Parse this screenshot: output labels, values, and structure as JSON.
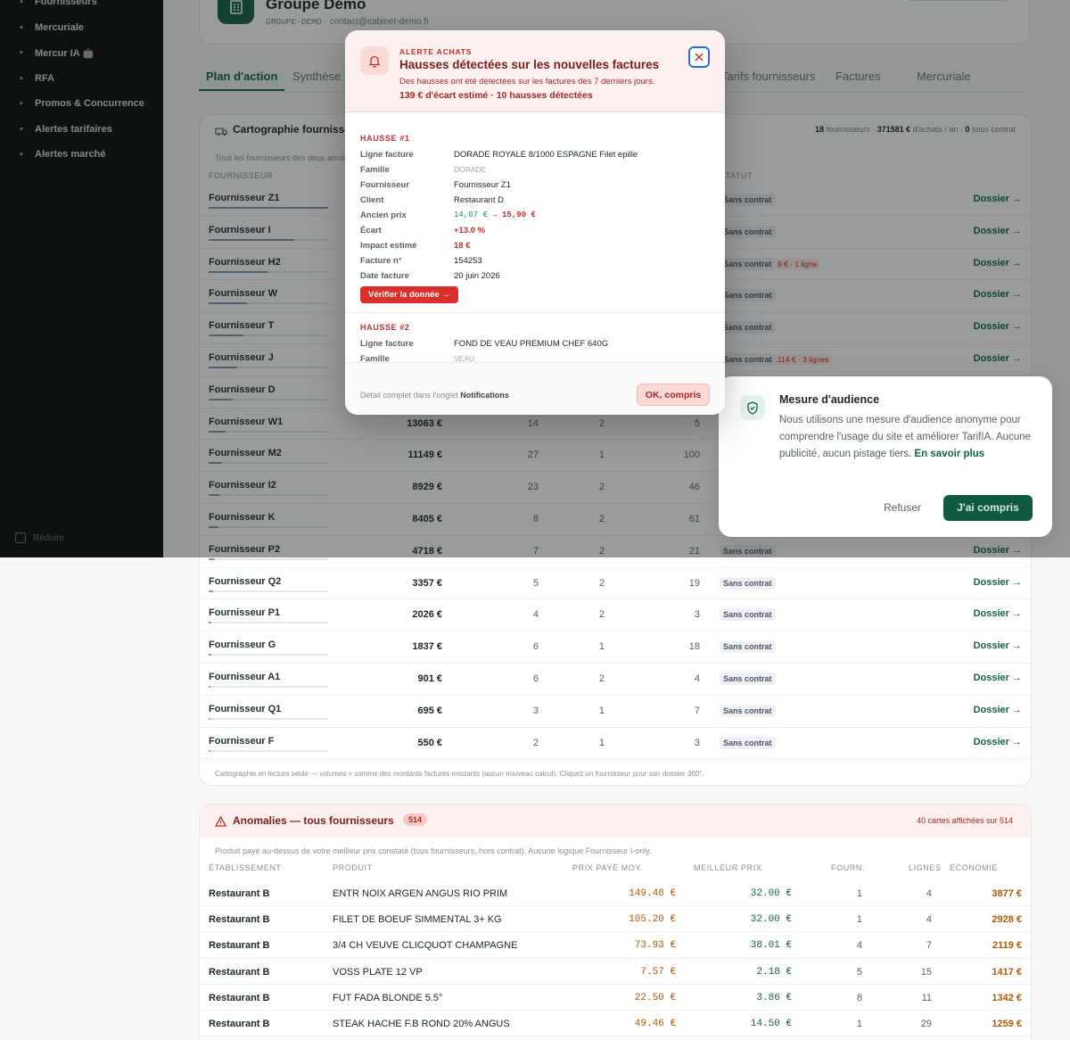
{
  "sidebar": {
    "items": [
      {
        "label": "Fournisseurs",
        "icon": "building-icon"
      },
      {
        "label": "Mercuriale",
        "icon": "chart-icon"
      },
      {
        "label": "Mercur IA 🤖",
        "icon": "sparkle-icon"
      },
      {
        "label": "RFA",
        "icon": "percent-icon"
      },
      {
        "label": "Promos & Concurrence",
        "icon": "flame-icon"
      },
      {
        "label": "Alertes tarifaires",
        "icon": "bell-icon"
      },
      {
        "label": "Alertes marché",
        "icon": "radar-icon"
      }
    ],
    "collapse_label": "Réduire"
  },
  "header": {
    "group_name": "Groupe Démo",
    "group_code": "GROUPE-DEMO",
    "email": "contact@cabinet-demo.fr"
  },
  "tabs": [
    "Plan d'action",
    "Synthèse",
    "Tarifs fournisseurs",
    "Factures",
    "Mercuriale"
  ],
  "carto": {
    "title": "Cartographie fournisseurs",
    "summary_prefix": "18",
    "summary_mid": " fournisseurs · ",
    "summary_amount": "371581 €",
    "summary_mid2": " d'achats / an · ",
    "summary_contract": "0",
    "summary_suffix": " sous contrat",
    "subtitle": "Tous les fournisseurs des deux années",
    "headers": {
      "supplier": "Fournisseur",
      "status": "Statut"
    },
    "rows": [
      {
        "name": "Fournisseur Z1",
        "volume": "",
        "c1": "",
        "c2": "",
        "c3": "",
        "status": "Sans contrat",
        "alert": "",
        "share": 1.0
      },
      {
        "name": "Fournisseur I",
        "volume": "",
        "c1": "",
        "c2": "",
        "c3": "",
        "status": "Sans contrat",
        "alert": "",
        "share": 0.72
      },
      {
        "name": "Fournisseur H2",
        "volume": "",
        "c1": "",
        "c2": "",
        "c3": "",
        "status": "Sans contrat",
        "alert": "9 € · 1 ligne",
        "share": 0.5
      },
      {
        "name": "Fournisseur W",
        "volume": "",
        "c1": "",
        "c2": "",
        "c3": "",
        "status": "Sans contrat",
        "alert": "",
        "share": 0.32
      },
      {
        "name": "Fournisseur T",
        "volume": "",
        "c1": "",
        "c2": "",
        "c3": "",
        "status": "Sans contrat",
        "alert": "",
        "share": 0.29
      },
      {
        "name": "Fournisseur J",
        "volume": "",
        "c1": "",
        "c2": "",
        "c3": "",
        "status": "Sans contrat",
        "alert": "114 € · 3 lignes",
        "share": 0.24
      },
      {
        "name": "Fournisseur D",
        "volume": "",
        "c1": "",
        "c2": "",
        "c3": "",
        "status": "",
        "alert": "",
        "share": 0.2
      },
      {
        "name": "Fournisseur W1",
        "volume": "13063 €",
        "c1": "14",
        "c2": "2",
        "c3": "5",
        "status": "",
        "alert": "",
        "share": 0.14
      },
      {
        "name": "Fournisseur M2",
        "volume": "11149 €",
        "c1": "27",
        "c2": "1",
        "c3": "100",
        "status": "",
        "alert": "",
        "share": 0.11
      },
      {
        "name": "Fournisseur I2",
        "volume": "8929 €",
        "c1": "23",
        "c2": "2",
        "c3": "46",
        "status": "",
        "alert": "",
        "share": 0.09
      },
      {
        "name": "Fournisseur K",
        "volume": "8405 €",
        "c1": "8",
        "c2": "2",
        "c3": "61",
        "status": "",
        "alert": "",
        "share": 0.085
      },
      {
        "name": "Fournisseur P2",
        "volume": "4718 €",
        "c1": "7",
        "c2": "2",
        "c3": "21",
        "status": "Sans contrat",
        "alert": "",
        "share": 0.05
      },
      {
        "name": "Fournisseur Q2",
        "volume": "3357 €",
        "c1": "5",
        "c2": "2",
        "c3": "19",
        "status": "Sans contrat",
        "alert": "",
        "share": 0.035
      },
      {
        "name": "Fournisseur P1",
        "volume": "2026 €",
        "c1": "4",
        "c2": "2",
        "c3": "3",
        "status": "Sans contrat",
        "alert": "",
        "share": 0.022
      },
      {
        "name": "Fournisseur G",
        "volume": "1837 €",
        "c1": "6",
        "c2": "1",
        "c3": "18",
        "status": "Sans contrat",
        "alert": "",
        "share": 0.02
      },
      {
        "name": "Fournisseur A1",
        "volume": "901 €",
        "c1": "6",
        "c2": "2",
        "c3": "4",
        "status": "Sans contrat",
        "alert": "",
        "share": 0.01
      },
      {
        "name": "Fournisseur Q1",
        "volume": "695 €",
        "c1": "3",
        "c2": "1",
        "c3": "7",
        "status": "Sans contrat",
        "alert": "",
        "share": 0.008
      },
      {
        "name": "Fournisseur F",
        "volume": "550 €",
        "c1": "2",
        "c2": "1",
        "c3": "3",
        "status": "Sans contrat",
        "alert": "",
        "share": 0.006
      }
    ],
    "dossier_label": "Dossier →",
    "footnote": "Cartographie en lecture seule — volumes = somme des montants facturés existants (aucun nouveau calcul). Cliquez un fournisseur pour son dossier 360°."
  },
  "anomalies": {
    "title": "Anomalies — tous fournisseurs",
    "count": "514",
    "shown": "40 cartes affichées sur 514",
    "subtitle": "Produit payé au-dessus de votre meilleur prix constaté (tous fournisseurs, hors contrat). Aucune logique Fournisseur I-only.",
    "headers": [
      "Établissement",
      "Produit",
      "Prix payé moy.",
      "Meilleur prix",
      "Fourn.",
      "Lignes",
      "Économie"
    ],
    "rows": [
      {
        "site": "Restaurant B",
        "product": "ENTR NOIX ARGEN ANGUS RIO PRIM",
        "paid": "149.48 €",
        "best": "32.00 €",
        "fourn": "1",
        "lines": "4",
        "saving": "3877 €"
      },
      {
        "site": "Restaurant B",
        "product": "FILET DE BOEUF SIMMENTAL 3+ KG",
        "paid": "105.20 €",
        "best": "32.00 €",
        "fourn": "1",
        "lines": "4",
        "saving": "2928 €"
      },
      {
        "site": "Restaurant B",
        "product": "3/4 CH VEUVE CLICQUOT CHAMPAGNE",
        "paid": "73.93 €",
        "best": "38.01 €",
        "fourn": "4",
        "lines": "7",
        "saving": "2119 €"
      },
      {
        "site": "Restaurant B",
        "product": "VOSS PLATE 12 VP",
        "paid": "7.57 €",
        "best": "2.18 €",
        "fourn": "5",
        "lines": "15",
        "saving": "1417 €"
      },
      {
        "site": "Restaurant B",
        "product": "FUT FADA BLONDE 5.5°",
        "paid": "22.50 €",
        "best": "3.86 €",
        "fourn": "8",
        "lines": "11",
        "saving": "1342 €"
      },
      {
        "site": "Restaurant B",
        "product": "STEAK HACHE F.B ROND 20% ANGUS",
        "paid": "49.46 €",
        "best": "14.50 €",
        "fourn": "1",
        "lines": "29",
        "saving": "1259 €"
      }
    ]
  },
  "modal": {
    "eyebrow": "ALERTE ACHATS",
    "title": "Hausses détectées sur les nouvelles factures",
    "desc": "Des hausses ont été détectées sur les factures des 7 derniers jours.",
    "summary": "139 € d'écart estimé · 10 hausses détectées",
    "hausse1": {
      "label": "HAUSSE #1",
      "k_line": "Ligne facture",
      "line": "DORADE ROYALE 8/1000 ESPAGNE Filet epille",
      "k_family": "Famille",
      "family": "DORADE",
      "k_supplier": "Fournisseur",
      "supplier": "Fournisseur Z1",
      "k_client": "Client",
      "client": "Restaurant D",
      "k_old": "Ancien prix",
      "old_price": "14,07 €",
      "new_price": "15,90 €",
      "k_gap": "Écart",
      "gap": "+13.0 %",
      "k_impact": "Impact estimé",
      "impact": "18 €",
      "k_invoice": "Facture n°",
      "invoice": "154253",
      "k_date": "Date facture",
      "date": "20 juin 2026",
      "verify": "Vérifier la donnée →"
    },
    "hausse2": {
      "label": "HAUSSE #2",
      "k_line": "Ligne facture",
      "line": "FOND DE VEAU PREMIUM CHEF 640G",
      "k_family": "Famille",
      "family": "VEAU"
    },
    "footer_text": "Détail complet dans l'onglet ",
    "footer_link": "Notifications",
    "ok": "OK, compris"
  },
  "consent": {
    "title": "Mesure d'audience",
    "text": "Nous utilisons une mesure d'audience anonyme pour comprendre l'usage du site et améliorer TarifIA. Aucune publicité, aucun pistage tiers. ",
    "link": "En savoir plus",
    "refuse": "Refuser",
    "accept": "J'ai compris"
  },
  "colors": {
    "brand": "#18624a",
    "alert": "#c0302b",
    "amber": "#b35a00"
  }
}
